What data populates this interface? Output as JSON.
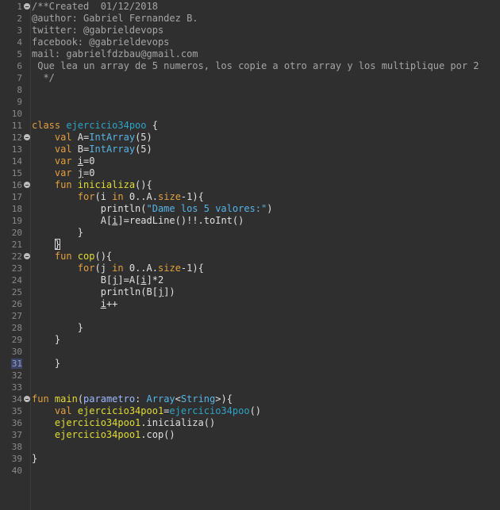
{
  "editor": {
    "lines": [
      {
        "n": "1",
        "fold": true,
        "tokens": [
          {
            "t": "/**Created  01/12/2018",
            "c": "comment"
          }
        ]
      },
      {
        "n": "2",
        "tokens": [
          {
            "t": "@author: Gabriel Fernandez B.",
            "c": "comment"
          }
        ]
      },
      {
        "n": "3",
        "tokens": [
          {
            "t": "twitter: @gabrieldevops",
            "c": "comment"
          }
        ]
      },
      {
        "n": "4",
        "tokens": [
          {
            "t": "facebook: @gabrieldevops",
            "c": "comment"
          }
        ]
      },
      {
        "n": "5",
        "tokens": [
          {
            "t": "mail: gabrielfdzbau@gmail.com",
            "c": "comment"
          }
        ]
      },
      {
        "n": "6",
        "tokens": [
          {
            "t": " Que lea un array de 5 numeros, los copie a otro array y los multiplique por 2",
            "c": "comment"
          }
        ]
      },
      {
        "n": "7",
        "tokens": [
          {
            "t": "  */",
            "c": "comment"
          }
        ]
      },
      {
        "n": "8",
        "tokens": []
      },
      {
        "n": "9",
        "tokens": []
      },
      {
        "n": "10",
        "tokens": []
      },
      {
        "n": "11",
        "tokens": [
          {
            "t": "class ",
            "c": "kw"
          },
          {
            "t": "ejercicio34poo",
            "c": "cls"
          },
          {
            "t": " {",
            "c": "def"
          }
        ]
      },
      {
        "n": "12",
        "fold": true,
        "tokens": [
          {
            "t": "    val ",
            "c": "kw"
          },
          {
            "t": "A",
            "c": "def"
          },
          {
            "t": "=",
            "c": "def"
          },
          {
            "t": "IntArray",
            "c": "typ"
          },
          {
            "t": "(5)",
            "c": "def"
          }
        ]
      },
      {
        "n": "13",
        "tokens": [
          {
            "t": "    val ",
            "c": "kw"
          },
          {
            "t": "B",
            "c": "def"
          },
          {
            "t": "=",
            "c": "def"
          },
          {
            "t": "IntArray",
            "c": "typ"
          },
          {
            "t": "(5)",
            "c": "def"
          }
        ]
      },
      {
        "n": "14",
        "tokens": [
          {
            "t": "    var ",
            "c": "kw"
          },
          {
            "t": "i",
            "c": "def",
            "u": true
          },
          {
            "t": "=0",
            "c": "def"
          }
        ]
      },
      {
        "n": "15",
        "tokens": [
          {
            "t": "    var ",
            "c": "kw"
          },
          {
            "t": "j",
            "c": "def",
            "u": true
          },
          {
            "t": "=0",
            "c": "def"
          }
        ]
      },
      {
        "n": "16",
        "fold": true,
        "tokens": [
          {
            "t": "    fun ",
            "c": "kw"
          },
          {
            "t": "inicializa",
            "c": "fn"
          },
          {
            "t": "(){",
            "c": "def"
          }
        ]
      },
      {
        "n": "17",
        "tokens": [
          {
            "t": "        for",
            "c": "kw"
          },
          {
            "t": "(",
            "c": "def"
          },
          {
            "t": "i",
            "c": "def"
          },
          {
            "t": " in ",
            "c": "kw"
          },
          {
            "t": "0..",
            "c": "def"
          },
          {
            "t": "A",
            "c": "def"
          },
          {
            "t": ".",
            "c": "def"
          },
          {
            "t": "size",
            "c": "kw"
          },
          {
            "t": "-1){",
            "c": "def"
          }
        ]
      },
      {
        "n": "18",
        "tokens": [
          {
            "t": "            println(",
            "c": "def"
          },
          {
            "t": "\"Dame los 5 valores:\"",
            "c": "str"
          },
          {
            "t": ")",
            "c": "def"
          }
        ]
      },
      {
        "n": "19",
        "tokens": [
          {
            "t": "            ",
            "c": "def"
          },
          {
            "t": "A",
            "c": "def"
          },
          {
            "t": "[",
            "c": "def"
          },
          {
            "t": "i",
            "c": "def",
            "u": true
          },
          {
            "t": "]=readLine()!!.toInt()",
            "c": "def"
          }
        ]
      },
      {
        "n": "20",
        "tokens": [
          {
            "t": "        }",
            "c": "def"
          }
        ]
      },
      {
        "n": "21",
        "tokens": [
          {
            "t": "    ",
            "c": "def"
          },
          {
            "t": "}",
            "c": "def",
            "box": true
          }
        ]
      },
      {
        "n": "22",
        "fold": true,
        "tokens": [
          {
            "t": "    fun ",
            "c": "kw"
          },
          {
            "t": "cop",
            "c": "fn"
          },
          {
            "t": "(){",
            "c": "def"
          }
        ]
      },
      {
        "n": "23",
        "tokens": [
          {
            "t": "        for",
            "c": "kw"
          },
          {
            "t": "(",
            "c": "def"
          },
          {
            "t": "j",
            "c": "def"
          },
          {
            "t": " in ",
            "c": "kw"
          },
          {
            "t": "0..",
            "c": "def"
          },
          {
            "t": "A",
            "c": "def"
          },
          {
            "t": ".",
            "c": "def"
          },
          {
            "t": "size",
            "c": "kw"
          },
          {
            "t": "-1){",
            "c": "def"
          }
        ]
      },
      {
        "n": "24",
        "tokens": [
          {
            "t": "            ",
            "c": "def"
          },
          {
            "t": "B",
            "c": "def"
          },
          {
            "t": "[",
            "c": "def"
          },
          {
            "t": "j",
            "c": "def",
            "u": true
          },
          {
            "t": "]=",
            "c": "def"
          },
          {
            "t": "A",
            "c": "def"
          },
          {
            "t": "[",
            "c": "def"
          },
          {
            "t": "i",
            "c": "def",
            "u": true
          },
          {
            "t": "]*2",
            "c": "def"
          }
        ]
      },
      {
        "n": "25",
        "tokens": [
          {
            "t": "            println(",
            "c": "def"
          },
          {
            "t": "B",
            "c": "def"
          },
          {
            "t": "[",
            "c": "def"
          },
          {
            "t": "j",
            "c": "def",
            "u": true
          },
          {
            "t": "])",
            "c": "def"
          }
        ]
      },
      {
        "n": "26",
        "tokens": [
          {
            "t": "            ",
            "c": "def"
          },
          {
            "t": "i",
            "c": "def",
            "u": true
          },
          {
            "t": "++",
            "c": "def"
          }
        ]
      },
      {
        "n": "27",
        "tokens": []
      },
      {
        "n": "28",
        "tokens": [
          {
            "t": "        }",
            "c": "def"
          }
        ]
      },
      {
        "n": "29",
        "tokens": [
          {
            "t": "    }",
            "c": "def"
          }
        ]
      },
      {
        "n": "30",
        "tokens": []
      },
      {
        "n": "31",
        "current": true,
        "tokens": [
          {
            "t": "    }",
            "c": "def"
          }
        ]
      },
      {
        "n": "32",
        "tokens": []
      },
      {
        "n": "33",
        "tokens": []
      },
      {
        "n": "34",
        "fold": true,
        "tokens": [
          {
            "t": "fun ",
            "c": "kw"
          },
          {
            "t": "main",
            "c": "fn"
          },
          {
            "t": "(",
            "c": "def"
          },
          {
            "t": "parametro",
            "c": "param"
          },
          {
            "t": ": ",
            "c": "def"
          },
          {
            "t": "Array",
            "c": "typ"
          },
          {
            "t": "<",
            "c": "def"
          },
          {
            "t": "String",
            "c": "typ"
          },
          {
            "t": ">){",
            "c": "def"
          }
        ]
      },
      {
        "n": "35",
        "tokens": [
          {
            "t": "    val ",
            "c": "kw"
          },
          {
            "t": "ejercicio34poo1",
            "c": "fn"
          },
          {
            "t": "=",
            "c": "def"
          },
          {
            "t": "ejercicio34poo",
            "c": "cls"
          },
          {
            "t": "()",
            "c": "def"
          }
        ]
      },
      {
        "n": "36",
        "tokens": [
          {
            "t": "    ",
            "c": "def"
          },
          {
            "t": "ejercicio34poo1",
            "c": "fn"
          },
          {
            "t": ".inicializa()",
            "c": "def"
          }
        ]
      },
      {
        "n": "37",
        "tokens": [
          {
            "t": "    ",
            "c": "def"
          },
          {
            "t": "ejercicio34poo1",
            "c": "fn"
          },
          {
            "t": ".cop()",
            "c": "def"
          }
        ]
      },
      {
        "n": "38",
        "tokens": []
      },
      {
        "n": "39",
        "tokens": [
          {
            "t": "}",
            "c": "def"
          }
        ]
      },
      {
        "n": "40",
        "tokens": []
      }
    ]
  }
}
